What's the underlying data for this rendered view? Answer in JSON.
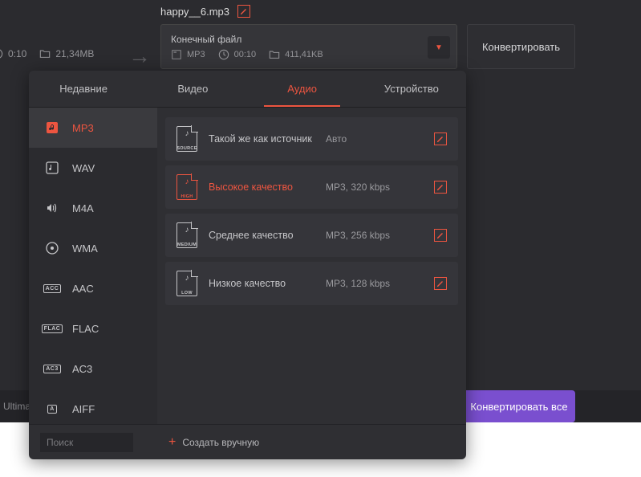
{
  "filename": "happy__6.mp3",
  "source": {
    "duration": "0:10",
    "size": "21,34MB"
  },
  "output": {
    "title": "Конечный файл",
    "format": "MP3",
    "duration": "00:10",
    "size": "411,41KB"
  },
  "convert_label": "Конвертировать",
  "bottom_label": "Ultima",
  "convert_all_label": "Конвертировать все",
  "tabs": {
    "recent": "Недавние",
    "video": "Видео",
    "audio": "Аудио",
    "device": "Устройство"
  },
  "formats": {
    "mp3": "MP3",
    "wav": "WAV",
    "m4a": "M4A",
    "wma": "WMA",
    "aac": "AAC",
    "flac": "FLAC",
    "ac3": "AC3",
    "aiff": "AIFF"
  },
  "presets": [
    {
      "doc_tag": "SOURCE",
      "name": "Такой же как источник",
      "spec": "Авто"
    },
    {
      "doc_tag": "HIGH",
      "name": "Высокое качество",
      "spec": "MP3, 320 kbps"
    },
    {
      "doc_tag": "MEDIUM",
      "name": "Среднее качество",
      "spec": "MP3, 256 kbps"
    },
    {
      "doc_tag": "LOW",
      "name": "Низкое качество",
      "spec": "MP3, 128 kbps"
    }
  ],
  "search_placeholder": "Поиск",
  "create_manual_label": "Создать вручную"
}
